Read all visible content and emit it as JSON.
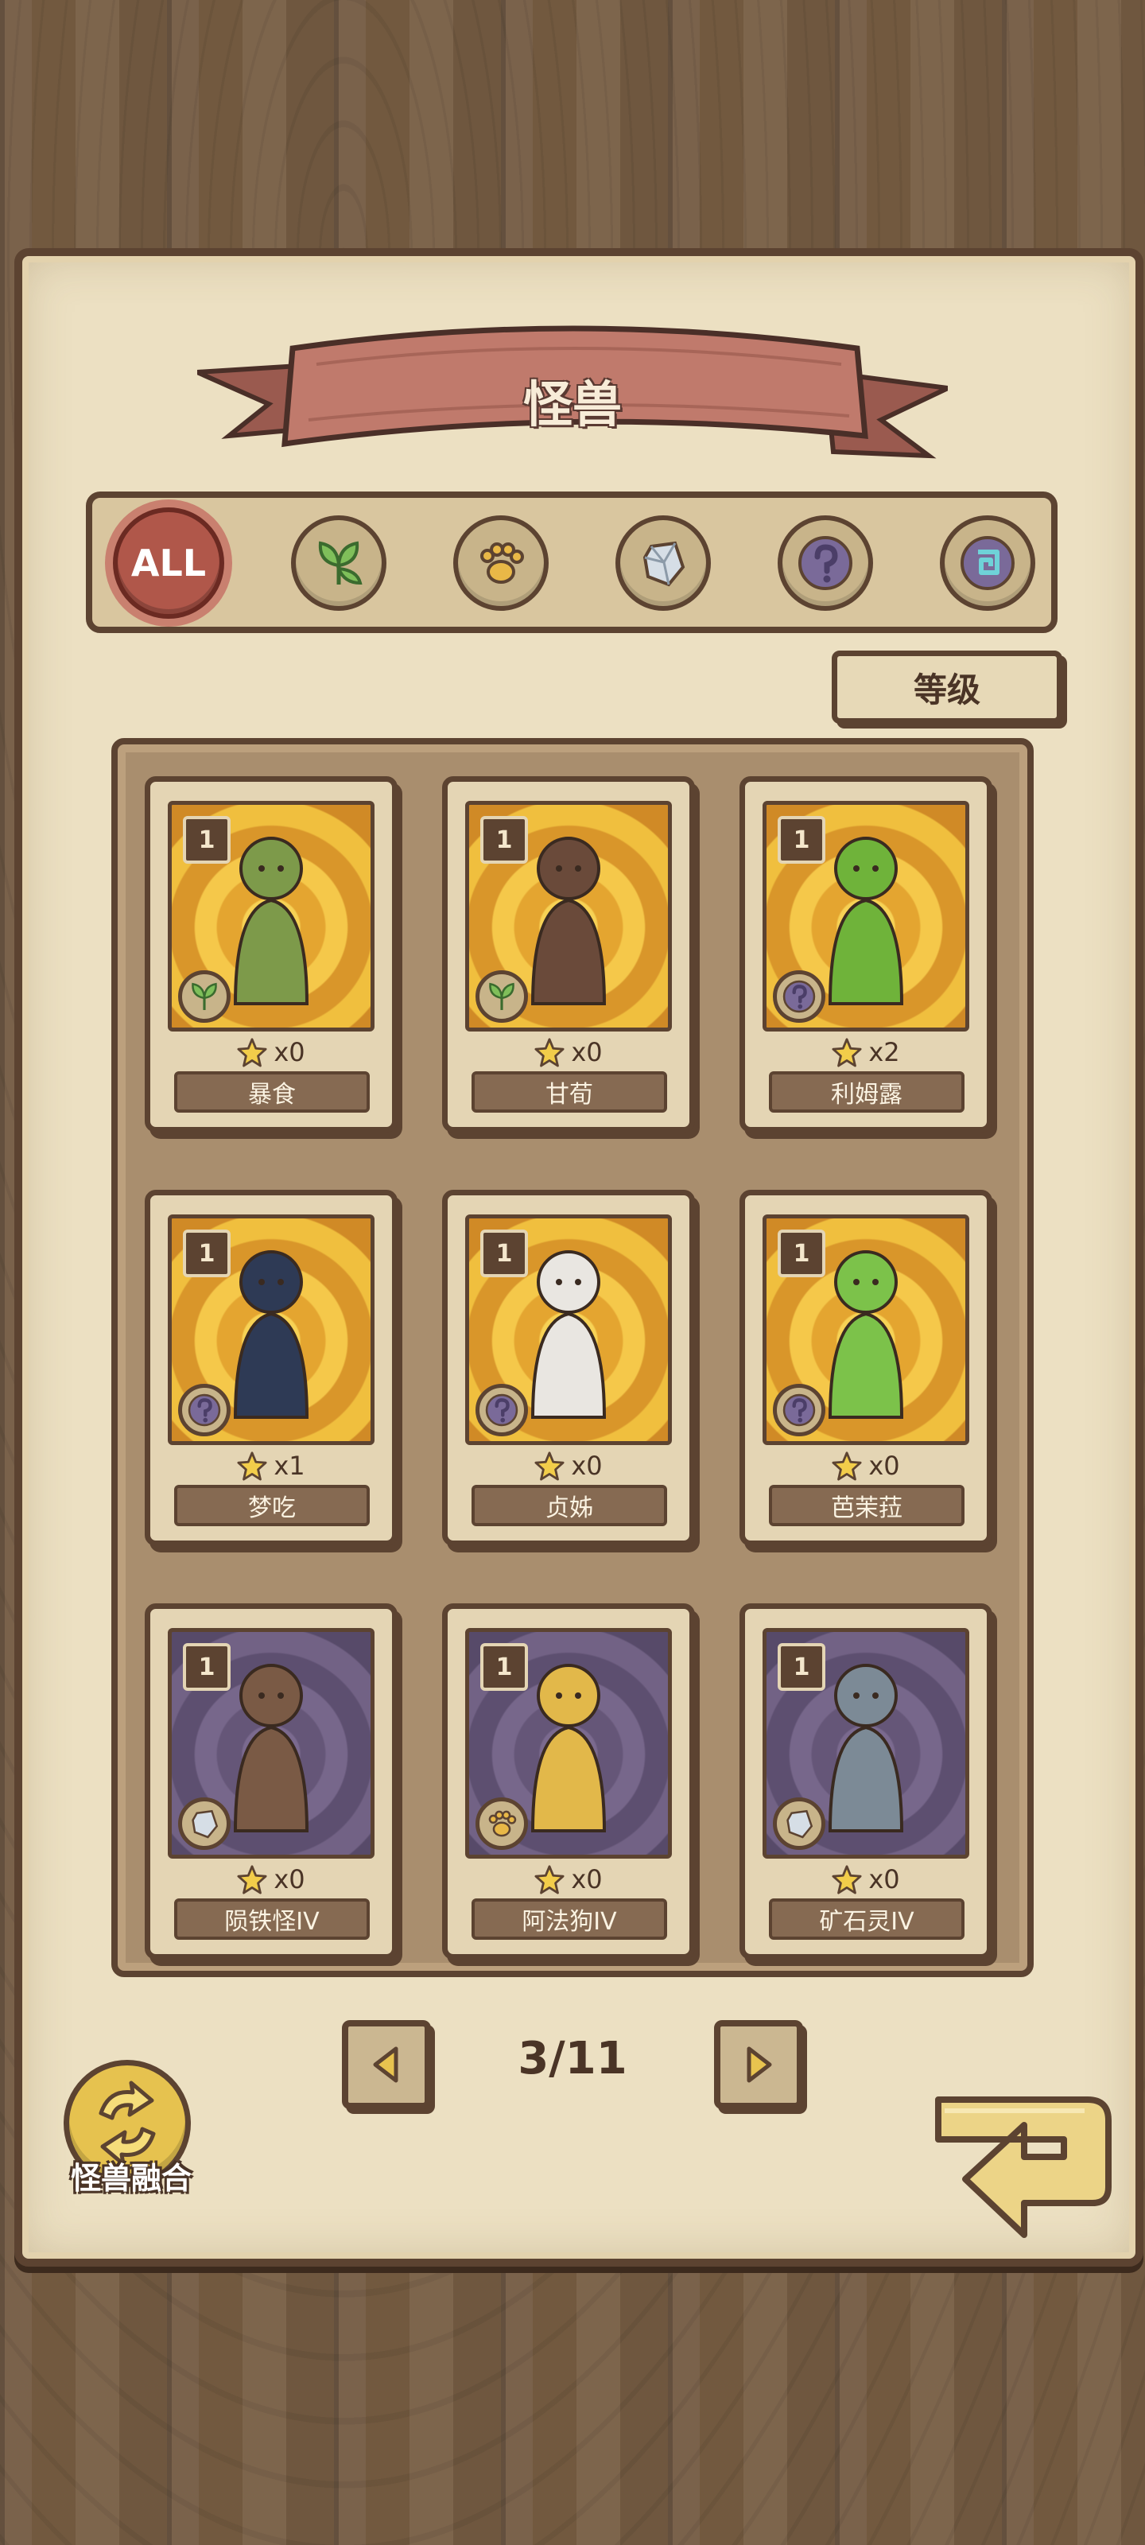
{
  "header": {
    "title": "怪兽"
  },
  "filters": [
    {
      "label": "ALL",
      "icon": "all-icon",
      "active": true
    },
    {
      "label": "",
      "icon": "leaf-icon",
      "active": false
    },
    {
      "label": "",
      "icon": "paw-icon",
      "active": false
    },
    {
      "label": "",
      "icon": "crystal-icon",
      "active": false
    },
    {
      "label": "",
      "icon": "question-icon",
      "active": false
    },
    {
      "label": "",
      "icon": "swirl-icon",
      "active": false
    }
  ],
  "sort": {
    "label": "等级"
  },
  "cards": [
    {
      "name": "暴食",
      "level": "1",
      "count": "x0",
      "type": "leaf-icon",
      "art": "gold",
      "figure": "#7d9a4a"
    },
    {
      "name": "甘荀",
      "level": "1",
      "count": "x0",
      "type": "leaf-icon",
      "art": "gold",
      "figure": "#6a4a3a"
    },
    {
      "name": "利姆露",
      "level": "1",
      "count": "x2",
      "type": "question-icon",
      "art": "gold",
      "figure": "#6fb33a"
    },
    {
      "name": "梦吃",
      "level": "1",
      "count": "x1",
      "type": "question-icon",
      "art": "gold",
      "figure": "#2e3a55"
    },
    {
      "name": "贞姊",
      "level": "1",
      "count": "x0",
      "type": "question-icon",
      "art": "gold",
      "figure": "#e9e6e1"
    },
    {
      "name": "芭茉菈",
      "level": "1",
      "count": "x0",
      "type": "question-icon",
      "art": "gold",
      "figure": "#7cc24a"
    },
    {
      "name": "陨铁怪IV",
      "level": "1",
      "count": "x0",
      "type": "crystal-icon",
      "art": "purple",
      "figure": "#7a5a45"
    },
    {
      "name": "阿法狗IV",
      "level": "1",
      "count": "x0",
      "type": "paw-icon",
      "art": "purple",
      "figure": "#e2b84a"
    },
    {
      "name": "矿石灵IV",
      "level": "1",
      "count": "x0",
      "type": "crystal-icon",
      "art": "purple",
      "figure": "#7c8a96"
    }
  ],
  "pagination": {
    "current_label": "3/11"
  },
  "fusion": {
    "label": "怪兽融合"
  },
  "colors": {
    "accent": "#b0574a",
    "frame": "#5c4331",
    "paper": "#ece0c2"
  }
}
